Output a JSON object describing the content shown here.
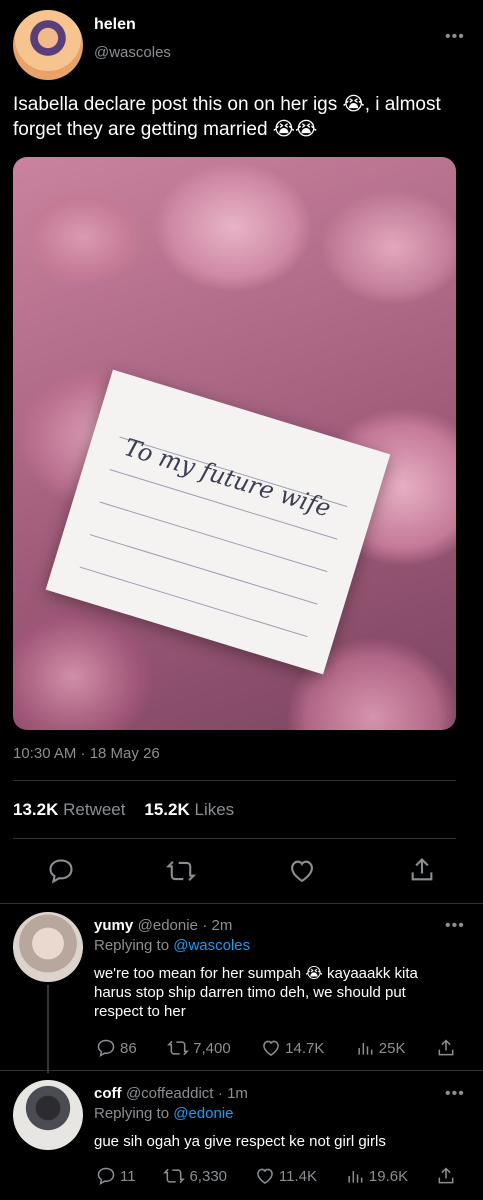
{
  "tweet": {
    "name": "helen",
    "handle": "@wascoles",
    "text": "Isabella declare post this on on her igs 😭, i almost forget they are getting married 😭😭",
    "photo_card_text": "To my future wife",
    "time": "10:30 AM · 18 May 26",
    "retweets_count": "13.2K",
    "retweets_label": "Retweet",
    "likes_count": "15.2K",
    "likes_label": "Likes"
  },
  "replies": [
    {
      "name": "yumy",
      "handle": "@edonie",
      "time": "· 2m",
      "replying_to_label": "Replying to",
      "replying_to": "@wascoles",
      "text": "we're too mean for her sumpah 😭 kayaaakk kita harus stop ship darren timo deh, we should put respect to her",
      "stats": {
        "replies": "86",
        "retweets": "7,400",
        "likes": "14.7K",
        "views": "25K"
      }
    },
    {
      "name": "coff",
      "handle": "@coffeaddict",
      "time": "· 1m",
      "replying_to_label": "Replying to",
      "replying_to": "@edonie",
      "text": "gue sih ogah ya give respect ke not girl girls",
      "stats": {
        "replies": "11",
        "retweets": "6,330",
        "likes": "11.4K",
        "views": "19.6K"
      }
    }
  ],
  "icons": {
    "more": "more-icon",
    "reply": "reply-icon",
    "retweet": "retweet-icon",
    "like": "heart-icon",
    "share": "share-icon",
    "views": "views-icon"
  },
  "colors": {
    "background": "#000000",
    "muted": "#8b8f93",
    "link": "#1d9bf0"
  },
  "more_glyph": "•••"
}
